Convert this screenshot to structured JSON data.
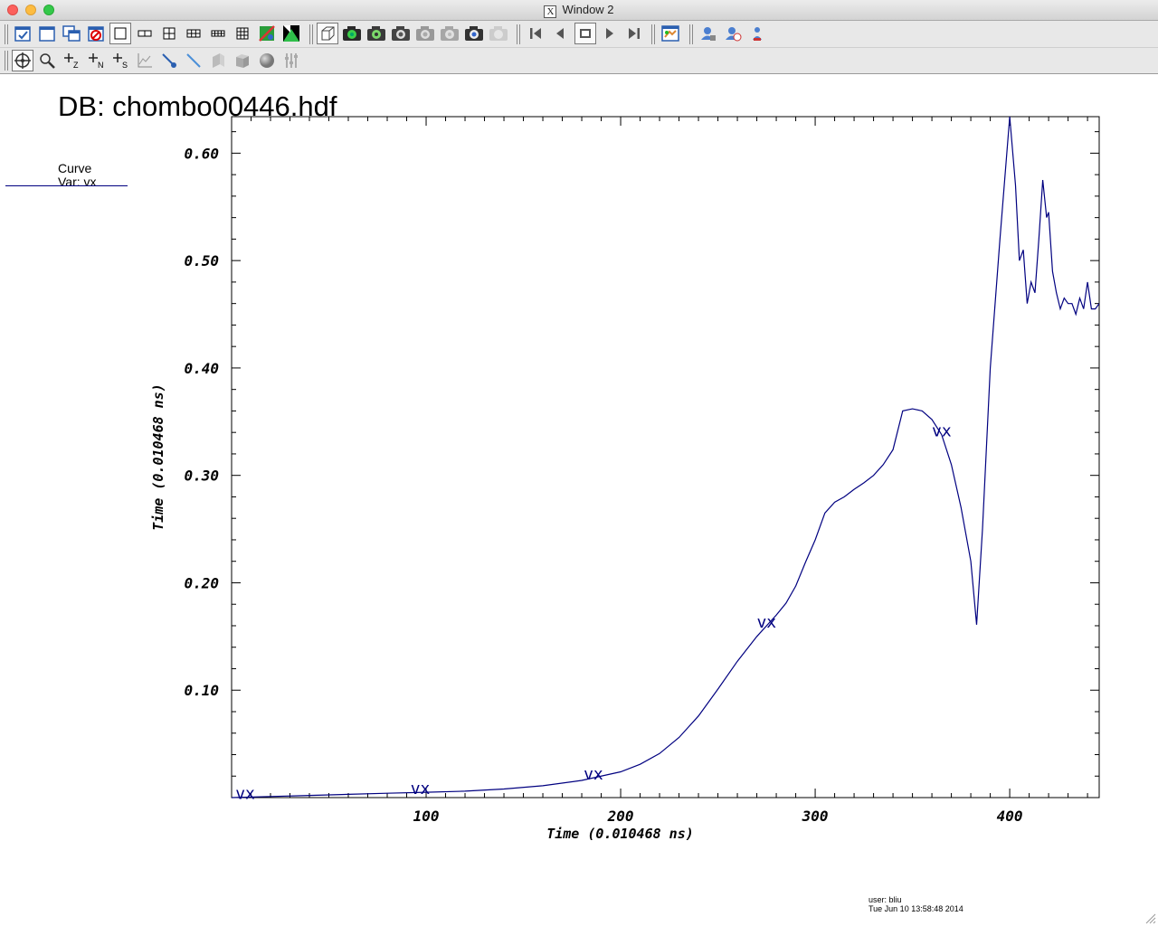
{
  "window": {
    "title": "Window 2"
  },
  "toolbar1": {
    "buttons": [
      "add-window-icon",
      "clone-window-icon",
      "copy-window-icon",
      "delete-window-icon",
      "layout-1x1-icon",
      "layout-1x2-icon",
      "layout-2x2-icon",
      "layout-2x3-icon",
      "layout-2x4-icon",
      "layout-3x3-icon",
      "spin-mode-icon",
      "invert-colors-icon",
      "view-3d-icon",
      "camera-green-1-icon",
      "camera-green-2-icon",
      "camera-icon",
      "camera-gray-1-icon",
      "camera-gray-2-icon",
      "camera-dark-icon",
      "camera-disabled-icon",
      "first-frame-icon",
      "reverse-play-icon",
      "stop-icon",
      "play-icon",
      "last-frame-icon",
      "output-window-icon",
      "lock-view-icon",
      "lock-time-icon",
      "lock-tools-icon"
    ]
  },
  "toolbar2": {
    "buttons": [
      "navigate-mode-icon",
      "zoom-mode-icon",
      "zone-pick-icon",
      "node-pick-icon",
      "spreadsheet-pick-icon",
      "lineout-icon",
      "point-tool-icon",
      "line-tool-icon",
      "plane-tool-icon",
      "box-tool-icon",
      "sphere-tool-icon",
      "axis-restrict-icon"
    ]
  },
  "plot": {
    "db_title": "DB: chombo00446.hdf",
    "legend_title": "Curve",
    "legend_var": "Var: vx",
    "curve_label": "vx",
    "xlabel": "Time (0.010468 ns)",
    "ylabel": "Time (0.010468 ns)",
    "colors": {
      "curve": "#000080",
      "axis": "#000000"
    }
  },
  "chart_data": {
    "type": "line",
    "title": "DB: chombo00446.hdf",
    "xlabel": "Time (0.010468 ns)",
    "ylabel": "Time (0.010468 ns)",
    "xlim": [
      0,
      446
    ],
    "ylim": [
      0,
      0.634
    ],
    "x_ticks": [
      100,
      200,
      300,
      400
    ],
    "x_tick_labels": [
      "100",
      "200",
      "300",
      "400"
    ],
    "y_ticks": [
      0.1,
      0.2,
      0.3,
      0.4,
      0.5,
      0.6
    ],
    "y_tick_labels": [
      "0.10",
      "0.20",
      "0.30",
      "0.40",
      "0.50",
      "0.60"
    ],
    "grid": false,
    "legend": "top-left",
    "series": [
      {
        "name": "vx",
        "x": [
          0,
          20,
          40,
          60,
          80,
          100,
          120,
          140,
          160,
          180,
          200,
          210,
          220,
          230,
          240,
          250,
          260,
          270,
          280,
          285,
          290,
          295,
          300,
          305,
          310,
          315,
          320,
          325,
          330,
          335,
          340,
          345,
          350,
          355,
          360,
          365,
          370,
          375,
          380,
          383,
          386,
          390,
          395,
          400,
          403,
          405,
          407,
          409,
          411,
          413,
          415,
          417,
          419,
          420,
          422,
          424,
          426,
          428,
          430,
          432,
          434,
          436,
          438,
          440,
          442,
          444,
          446
        ],
        "y": [
          0.0,
          0.001,
          0.002,
          0.003,
          0.004,
          0.005,
          0.006,
          0.008,
          0.011,
          0.016,
          0.024,
          0.031,
          0.041,
          0.056,
          0.076,
          0.101,
          0.127,
          0.15,
          0.17,
          0.181,
          0.197,
          0.219,
          0.24,
          0.265,
          0.275,
          0.28,
          0.287,
          0.293,
          0.3,
          0.31,
          0.324,
          0.36,
          0.362,
          0.36,
          0.352,
          0.338,
          0.31,
          0.27,
          0.22,
          0.161,
          0.25,
          0.4,
          0.52,
          0.634,
          0.57,
          0.5,
          0.51,
          0.46,
          0.48,
          0.47,
          0.52,
          0.575,
          0.54,
          0.545,
          0.49,
          0.47,
          0.455,
          0.465,
          0.46,
          0.46,
          0.45,
          0.465,
          0.455,
          0.48,
          0.455,
          0.455,
          0.46
        ]
      }
    ],
    "annotations": [
      "vx",
      "vx",
      "vx",
      "vx",
      "vx"
    ],
    "annotation_x": [
      7,
      97,
      186,
      275,
      365
    ]
  },
  "footer": {
    "user": "user: bliu",
    "timestamp": "Tue Jun 10 13:58:48 2014"
  }
}
